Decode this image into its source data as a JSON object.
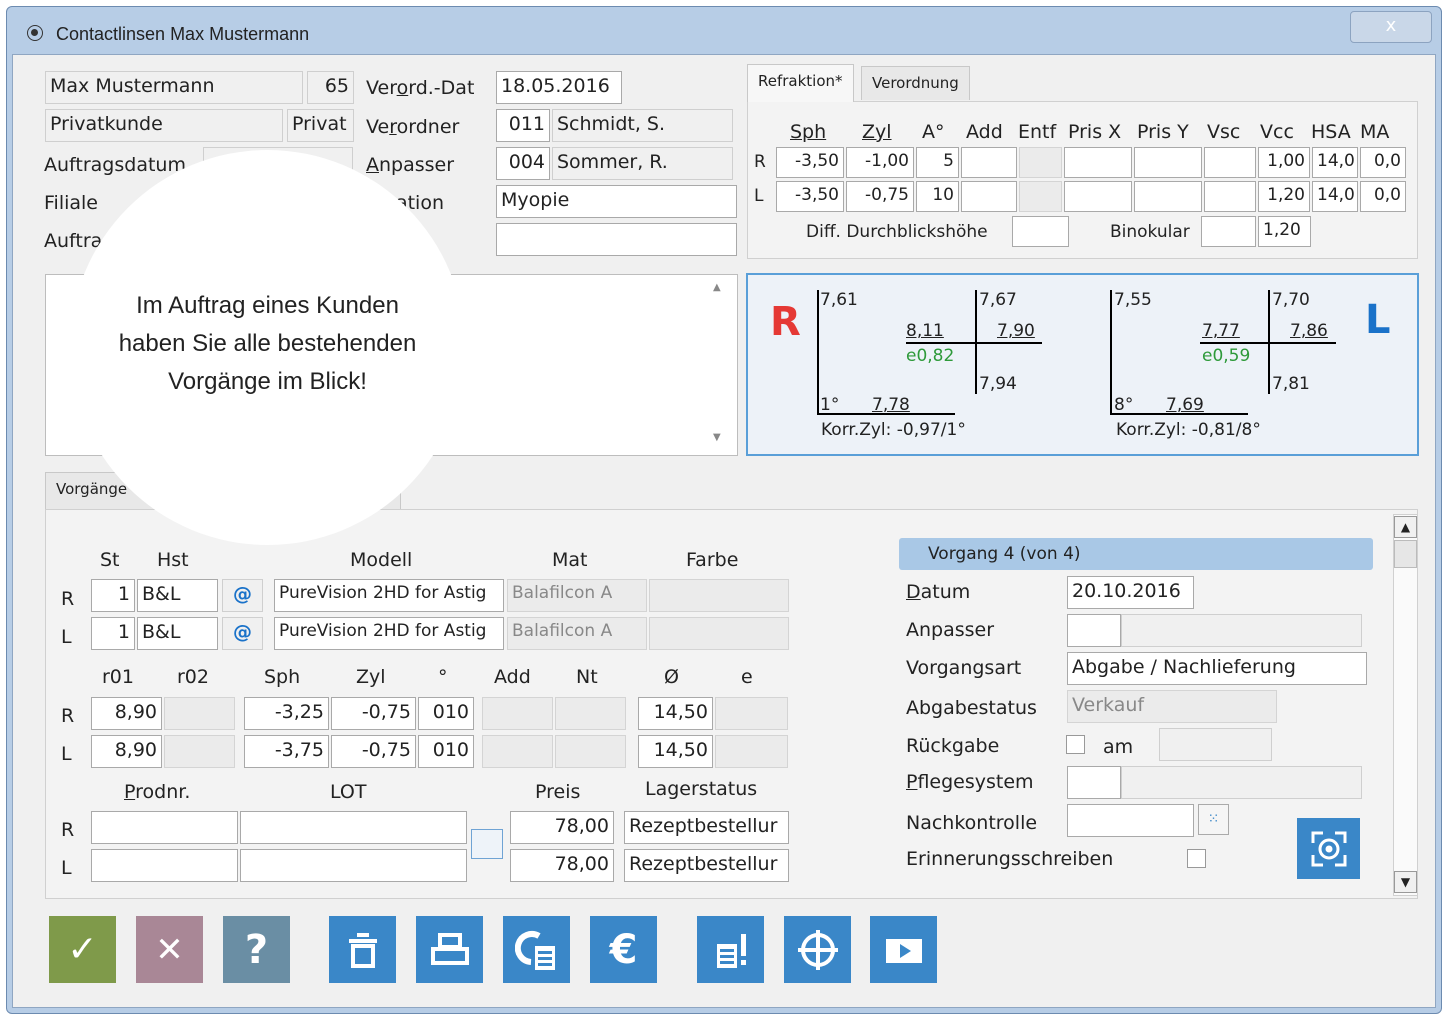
{
  "window": {
    "title": "Contactlinsen Max Mustermann",
    "close": "x"
  },
  "patient": {
    "name": "Max Mustermann",
    "age": "65",
    "type": "Privatkunde",
    "type_short": "Privat"
  },
  "left_labels": {
    "auftragsdatum": "Auftragsdatum",
    "filiale": "Filiale",
    "auftrag": "Auftra"
  },
  "prescription": {
    "date_label": "Verord.-Dat",
    "date": "18.05.2016",
    "prescriber_label": "Verordner",
    "prescriber_code": "011",
    "prescriber_name": "Schmidt, S.",
    "fitter_label": "Anpasser",
    "fitter_code": "004",
    "fitter_name": "Sommer, R.",
    "indication_label": "ikation",
    "indication": "Myopie",
    "extra": ""
  },
  "overlay": {
    "line1": "Im Auftrag eines Kunden",
    "line2": "haben Sie alle bestehenden",
    "line3": "Vorgänge im Blick!"
  },
  "refraction": {
    "tab1": "Refraktion*",
    "tab2": "Verordnung",
    "headers": [
      "Sph",
      "Zyl",
      "A°",
      "Add",
      "Entf",
      "Pris X",
      "Pris Y",
      "Vsc",
      "Vcc",
      "HSA",
      "MA"
    ],
    "rows": [
      {
        "eye": "R",
        "sph": "-3,50",
        "zyl": "-1,00",
        "a": "5",
        "vcc": "1,00",
        "hsa": "14,0",
        "ma": "0,0"
      },
      {
        "eye": "L",
        "sph": "-3,50",
        "zyl": "-0,75",
        "a": "10",
        "vcc": "1,20",
        "hsa": "14,0",
        "ma": "0,0"
      }
    ],
    "diff_label": "Diff. Durchblickshöhe",
    "bino_label": "Binokular",
    "bino": "1,20"
  },
  "kerato": {
    "R": {
      "letter": "R",
      "top_left": "7,61",
      "top_right": "7,67",
      "mid_left": "8,11",
      "mid_right": "7,90",
      "e": "e0,82",
      "bottom_right": "7,94",
      "axis": "1°",
      "bottom_val": "7,78",
      "korr": "Korr.Zyl:  -0,97/1°"
    },
    "L": {
      "letter": "L",
      "top_left": "7,55",
      "top_right": "7,70",
      "mid_left": "7,77",
      "mid_right": "7,86",
      "e": "e0,59",
      "bottom_right": "7,81",
      "axis": "8°",
      "bottom_val": "7,69",
      "korr": "Korr.Zyl:  -0,81/8°"
    }
  },
  "vorgaenge_tab": "Vorgänge",
  "lens": {
    "headers": {
      "st": "St",
      "hst": "Hst",
      "modell": "Modell",
      "mat": "Mat",
      "farbe": "Farbe"
    },
    "rows": [
      {
        "eye": "R",
        "st": "1",
        "hst": "B&L",
        "at": "@",
        "modell": "PureVision 2HD for Astig",
        "mat": "Balafilcon A",
        "farbe": ""
      },
      {
        "eye": "L",
        "st": "1",
        "hst": "B&L",
        "at": "@",
        "modell": "PureVision 2HD for Astig",
        "mat": "Balafilcon A",
        "farbe": ""
      }
    ]
  },
  "params": {
    "headers": [
      "r01",
      "r02",
      "Sph",
      "Zyl",
      "°",
      "Add",
      "Nt",
      "Ø",
      "e"
    ],
    "rows": [
      {
        "eye": "R",
        "r01": "8,90",
        "sph": "-3,25",
        "zyl": "-0,75",
        "deg": "010",
        "dia": "14,50"
      },
      {
        "eye": "L",
        "r01": "8,90",
        "sph": "-3,75",
        "zyl": "-0,75",
        "deg": "010",
        "dia": "14,50"
      }
    ]
  },
  "product": {
    "prodnr": "Prodnr.",
    "lot": "LOT",
    "preis": "Preis",
    "lager": "Lagerstatus",
    "rows": [
      {
        "eye": "R",
        "preis": "78,00",
        "status": "Rezeptbestellur"
      },
      {
        "eye": "L",
        "preis": "78,00",
        "status": "Rezeptbestellur"
      }
    ]
  },
  "vorgang": {
    "header": "Vorgang 4  (von 4)",
    "datum_label": "Datum",
    "datum": "20.10.2016",
    "anpasser_label": "Anpasser",
    "art_label": "Vorgangsart",
    "art": "Abgabe / Nachlieferung",
    "status_label": "Abgabestatus",
    "status": "Verkauf",
    "rueck_label": "Rückgabe",
    "am": "am",
    "pflege_label": "Pflegesystem",
    "nachk_label": "Nachkontrolle",
    "erinn_label": "Erinnerungsschreiben"
  },
  "colors": {
    "ok": "#7f9a4a",
    "cancel": "#a98796",
    "help": "#6a8ea4",
    "blue": "#3a87c8",
    "kerato_border": "#5a9fd8",
    "red": "#e53935"
  }
}
